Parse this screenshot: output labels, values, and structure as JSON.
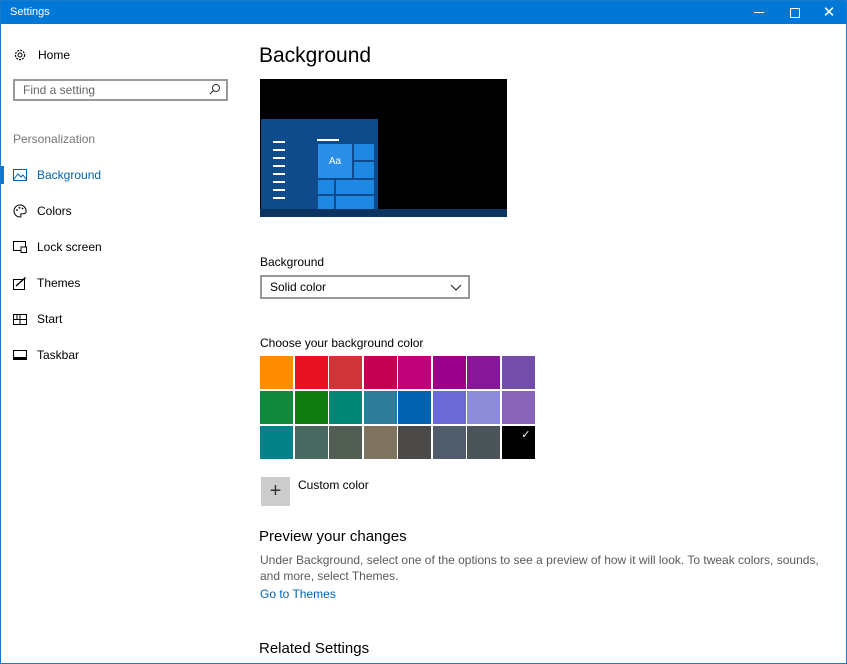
{
  "window": {
    "title": "Settings",
    "controls": {
      "minimize": "—",
      "maximize": "□",
      "close": "✕"
    }
  },
  "sidebar": {
    "home_label": "Home",
    "search_placeholder": "Find a setting",
    "section_label": "Personalization",
    "items": [
      {
        "label": "Background",
        "icon": "picture-icon",
        "active": true
      },
      {
        "label": "Colors",
        "icon": "palette-icon",
        "active": false
      },
      {
        "label": "Lock screen",
        "icon": "lock-screen-icon",
        "active": false
      },
      {
        "label": "Themes",
        "icon": "themes-icon",
        "active": false
      },
      {
        "label": "Start",
        "icon": "start-icon",
        "active": false
      },
      {
        "label": "Taskbar",
        "icon": "taskbar-icon",
        "active": false
      }
    ]
  },
  "main": {
    "title": "Background",
    "preview_tile_text": "Aa",
    "background_label": "Background",
    "background_value": "Solid color",
    "choose_color_label": "Choose your background color",
    "colors": [
      [
        "#ff8c00",
        "#e81123",
        "#d13438",
        "#c30052",
        "#bf0077",
        "#9a0089",
        "#881798",
        "#744da9"
      ],
      [
        "#10893e",
        "#107c10",
        "#018574",
        "#2d7d9a",
        "#0063b1",
        "#6b69d6",
        "#8e8cd8",
        "#8764b8"
      ],
      [
        "#038387",
        "#486860",
        "#525e54",
        "#7e735f",
        "#4c4a48",
        "#515c6b",
        "#4a5459",
        "#000000"
      ]
    ],
    "selected_color": "#000000",
    "custom_color_label": "Custom color",
    "preview_heading": "Preview your changes",
    "preview_desc": "Under Background, select one of the options to see a preview of how it will look. To tweak colors, sounds, and more, select Themes.",
    "themes_link": "Go to Themes",
    "related_heading": "Related Settings"
  },
  "colors": {
    "accent": "#0078d7",
    "link": "#0063b1",
    "titlebar": "#0078d7"
  }
}
